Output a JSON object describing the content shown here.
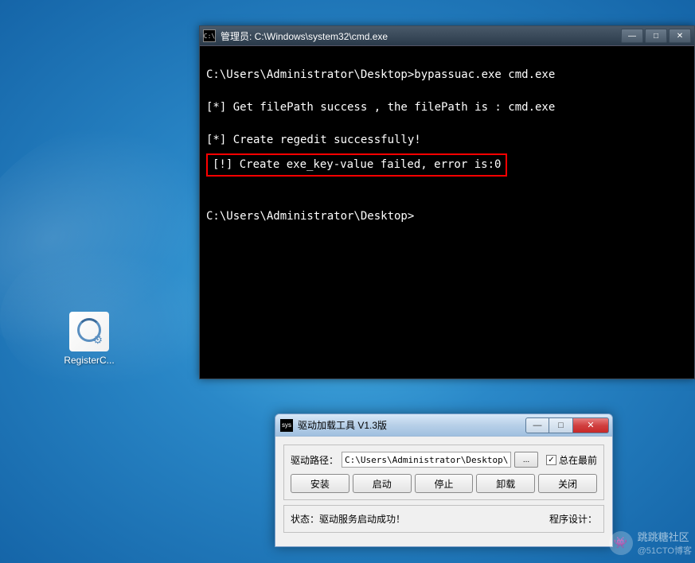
{
  "desktop": {
    "icon_label": "RegisterC..."
  },
  "cmd_window": {
    "title": "管理员: C:\\Windows\\system32\\cmd.exe",
    "icon_text": "C:\\",
    "lines": {
      "l1": "C:\\Users\\Administrator\\Desktop>bypassuac.exe cmd.exe",
      "l2": "[*] Get filePath success , the filePath is : cmd.exe",
      "l3": "[*] Create regedit successfully!",
      "l4": "[!] Create exe_key-value failed, error is:0",
      "l5": "C:\\Users\\Administrator\\Desktop>"
    },
    "buttons": {
      "min": "—",
      "max": "□",
      "close": "✕"
    }
  },
  "driver_tool": {
    "title": "驱动加载工具 V1.3版",
    "icon_text": "sys",
    "path_label": "驱动路径：",
    "path_value": "C:\\Users\\Administrator\\Desktop\\Reg",
    "browse_label": "...",
    "always_on_top": {
      "checked": "✓",
      "label": "总在最前"
    },
    "buttons": {
      "install": "安装",
      "start": "启动",
      "stop": "停止",
      "uninstall": "卸载",
      "close": "关闭"
    },
    "status": {
      "label": "状态：",
      "text": "驱动服务启动成功！",
      "footer_label": "程序设计："
    },
    "win_buttons": {
      "min": "—",
      "max": "□",
      "close": "✕"
    }
  },
  "watermark": {
    "emoji": "👾",
    "text": "跳跳糖社区",
    "sub": "@51CTO博客"
  }
}
